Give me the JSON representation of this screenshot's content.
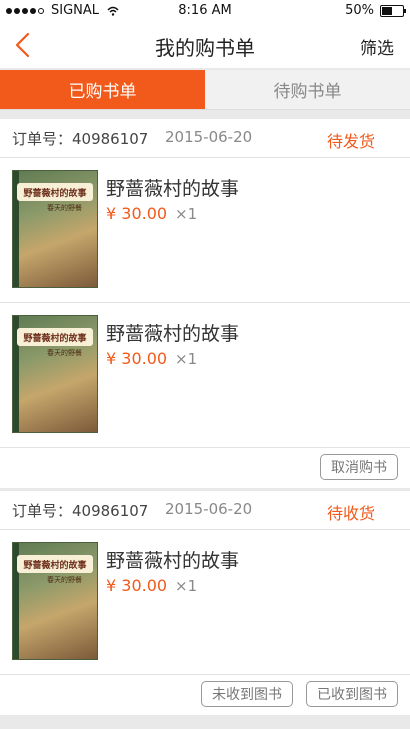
{
  "status_bar": {
    "carrier": "SIGNAL",
    "time": "8:16 AM",
    "battery": "50%"
  },
  "nav": {
    "back_icon": "chevron-left-icon",
    "title": "我的购书单",
    "filter_label": "筛选"
  },
  "tabs": [
    {
      "label": "已购书单",
      "active": true
    },
    {
      "label": "待购书单",
      "active": false
    }
  ],
  "orders": [
    {
      "order_no": "订单号：40986107",
      "date": "2015-06-20",
      "status": "待发货",
      "items": [
        {
          "title": "野蔷薇村的故事",
          "price": "¥ 30.00",
          "qty": "×1",
          "cover_title": "野蔷薇村的故事",
          "cover_subtitle": "春天的野餐"
        },
        {
          "title": "野蔷薇村的故事",
          "price": "¥ 30.00",
          "qty": "×1",
          "cover_title": "野蔷薇村的故事",
          "cover_subtitle": "春天的野餐"
        }
      ],
      "actions": [
        "取消购书"
      ]
    },
    {
      "order_no": "订单号：40986107",
      "date": "2015-06-20",
      "status": "待收货",
      "items": [
        {
          "title": "野蔷薇村的故事",
          "price": "¥ 30.00",
          "qty": "×1",
          "cover_title": "野蔷薇村的故事",
          "cover_subtitle": "春天的野餐"
        }
      ],
      "actions": [
        "未收到图书",
        "已收到图书"
      ]
    }
  ],
  "colors": {
    "accent": "#f15a1b",
    "background": "#e9e9e9"
  }
}
